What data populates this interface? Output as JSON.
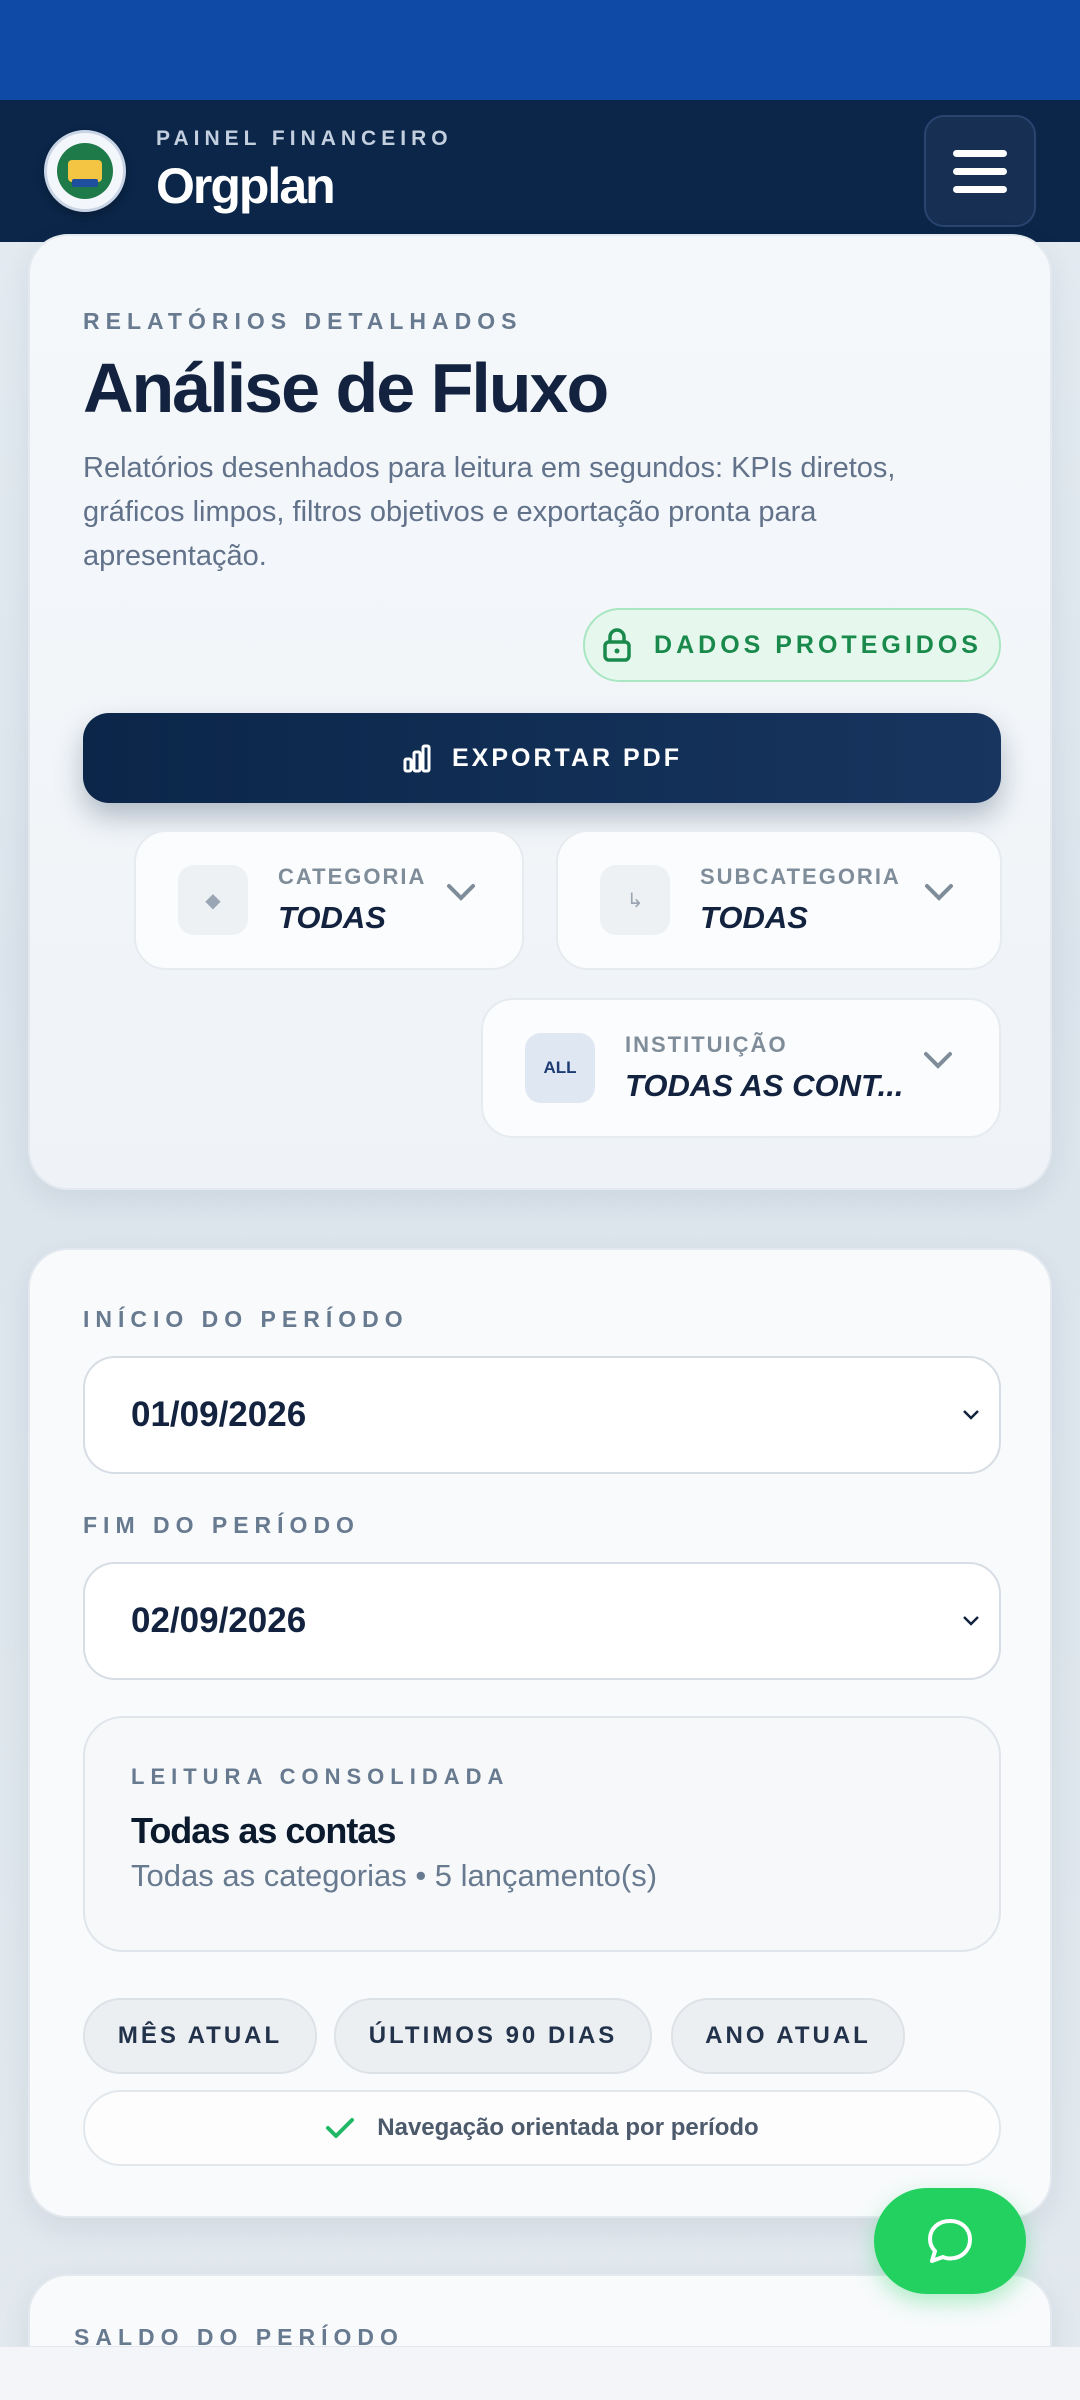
{
  "header": {
    "kicker": "PAINEL FINANCEIRO",
    "title": "Orgplan",
    "menu_icon": "hamburger-menu-icon"
  },
  "report": {
    "kicker": "RELATÓRIOS DETALHADOS",
    "title": "Análise de Fluxo",
    "description": "Relatórios desenhados para leitura em segundos: KPIs diretos, gráficos limpos, filtros objetivos e exportação pronta para apresentação.",
    "protected_badge": "DADOS PROTEGIDOS",
    "export_button": "EXPORTAR PDF"
  },
  "filters": {
    "category": {
      "label": "CATEGORIA",
      "value": "TODAS",
      "icon": "◆"
    },
    "subcategory": {
      "label": "SUBCATEGORIA",
      "value": "TODAS",
      "icon": "↳"
    },
    "institution": {
      "label": "INSTITUIÇÃO",
      "value": "TODAS AS CONT...",
      "icon": "ALL"
    }
  },
  "period": {
    "start_label": "INÍCIO DO PERÍODO",
    "start_value": "01/09/2026",
    "end_label": "FIM DO PERÍODO",
    "end_value": "02/09/2026"
  },
  "summary": {
    "kicker": "LEITURA CONSOLIDADA",
    "title": "Todas as contas",
    "subtitle": "Todas as categorias • 5 lançamento(s)"
  },
  "quick_ranges": [
    "MÊS ATUAL",
    "ÚLTIMOS 90 DIAS",
    "ANO ATUAL"
  ],
  "nav_hint": "Navegação orientada por período",
  "balance": {
    "kicker": "SALDO DO PERÍODO"
  },
  "colors": {
    "primary": "#0b2649",
    "status_bar": "#0f4aa6",
    "success": "#1a8a4c",
    "fab": "#23d160"
  }
}
